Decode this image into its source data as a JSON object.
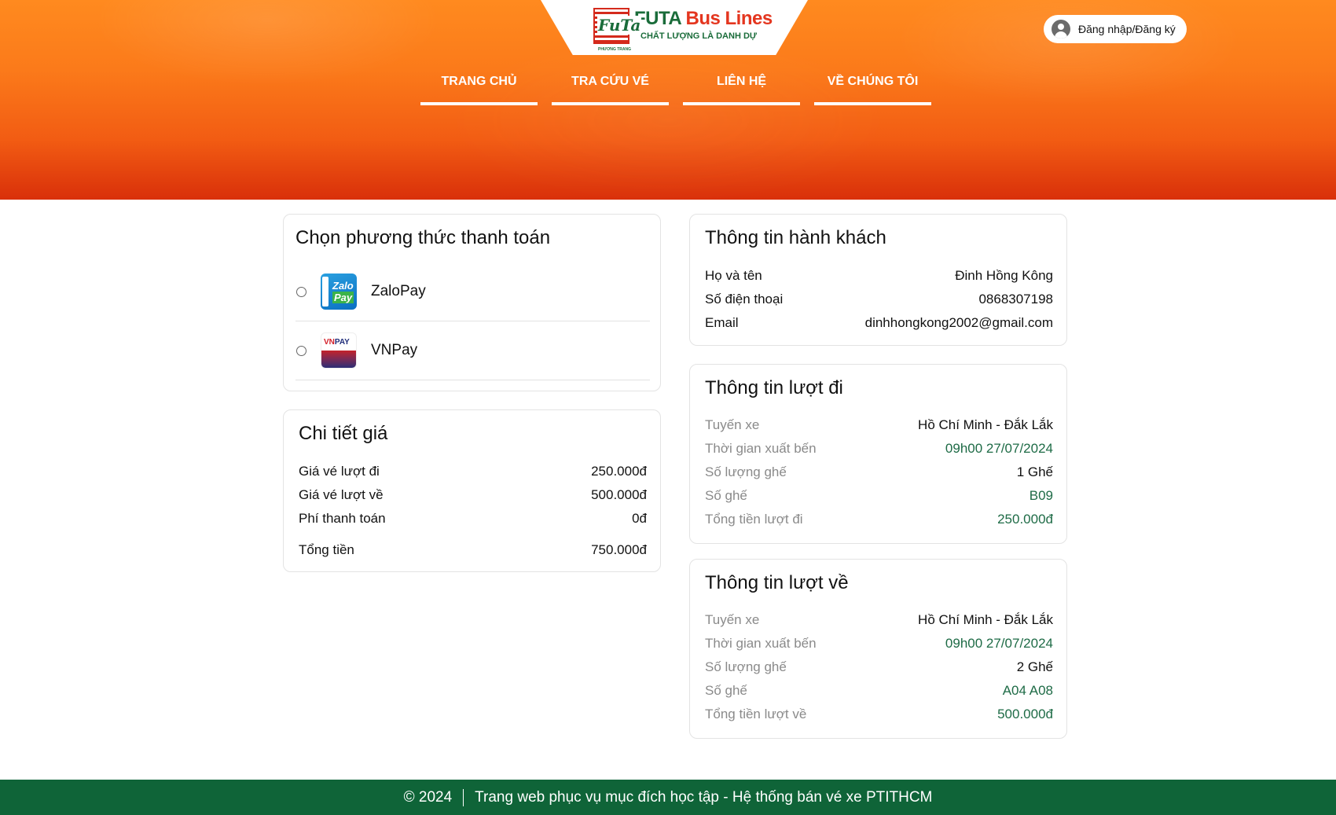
{
  "brand": {
    "mark_text": "FuTa",
    "mark_sub": "PHƯƠNG TRANG",
    "name_part1": "FUTA",
    "name_part2": "Bus Lines",
    "slogan": "CHẤT LƯỢNG LÀ DANH DỰ",
    "colors": {
      "green": "#1a6c3a",
      "red": "#e4361f",
      "header_orange": "#fb7a1a",
      "footer_green": "#0f6438"
    }
  },
  "header": {
    "login_label": "Đăng nhập/Đăng ký",
    "login_icon": "user-circle-icon",
    "nav": [
      {
        "label": "TRANG CHỦ"
      },
      {
        "label": "TRA CỨU VÉ"
      },
      {
        "label": "LIÊN HỆ"
      },
      {
        "label": "VỀ CHÚNG TÔI"
      }
    ]
  },
  "payment": {
    "title": "Chọn phương thức thanh toán",
    "methods": [
      {
        "label": "ZaloPay",
        "icon": "zalopay-logo",
        "logo_line1": "Zalo",
        "logo_line2": "Pay",
        "selected": false
      },
      {
        "label": "VNPay",
        "icon": "vnpay-logo",
        "logo_vn": "VN",
        "logo_pay": "PAY",
        "selected": false
      }
    ]
  },
  "price": {
    "title": "Chi tiết giá",
    "rows": [
      {
        "label": "Giá vé lượt đi",
        "value": "250.000đ"
      },
      {
        "label": "Giá vé lượt về",
        "value": "500.000đ"
      },
      {
        "label": "Phí thanh toán",
        "value": "0đ"
      }
    ],
    "total_label": "Tổng tiền",
    "total_value": "750.000đ"
  },
  "passenger": {
    "title": "Thông tin hành khách",
    "rows": [
      {
        "label": "Họ và tên",
        "value": "Đinh Hồng Kông"
      },
      {
        "label": "Số điện thoại",
        "value": "0868307198"
      },
      {
        "label": "Email",
        "value": "dinhhongkong2002@gmail.com"
      }
    ]
  },
  "outbound": {
    "title": "Thông tin lượt đi",
    "rows": [
      {
        "label": "Tuyến xe",
        "value": "Hồ Chí Minh - Đắk Lắk"
      },
      {
        "label": "Thời gian xuất bến",
        "value": "09h00 27/07/2024"
      },
      {
        "label": "Số lượng ghế",
        "value": "1 Ghế"
      },
      {
        "label": "Số ghế",
        "value": "B09"
      },
      {
        "label": "Tổng tiền lượt đi",
        "value": "250.000đ"
      }
    ]
  },
  "return": {
    "title": "Thông tin lượt về",
    "rows": [
      {
        "label": "Tuyến xe",
        "value": "Hồ Chí Minh - Đắk Lắk"
      },
      {
        "label": "Thời gian xuất bến",
        "value": "09h00 27/07/2024"
      },
      {
        "label": "Số lượng ghế",
        "value": "2 Ghế"
      },
      {
        "label": "Số ghế",
        "value": "A04 A08"
      },
      {
        "label": "Tổng tiền lượt về",
        "value": "500.000đ"
      }
    ]
  },
  "footer": {
    "copyright": "© 2024",
    "text": "Trang web phục vụ mục đích học tập - Hệ thống bán vé xe PTITHCM"
  }
}
